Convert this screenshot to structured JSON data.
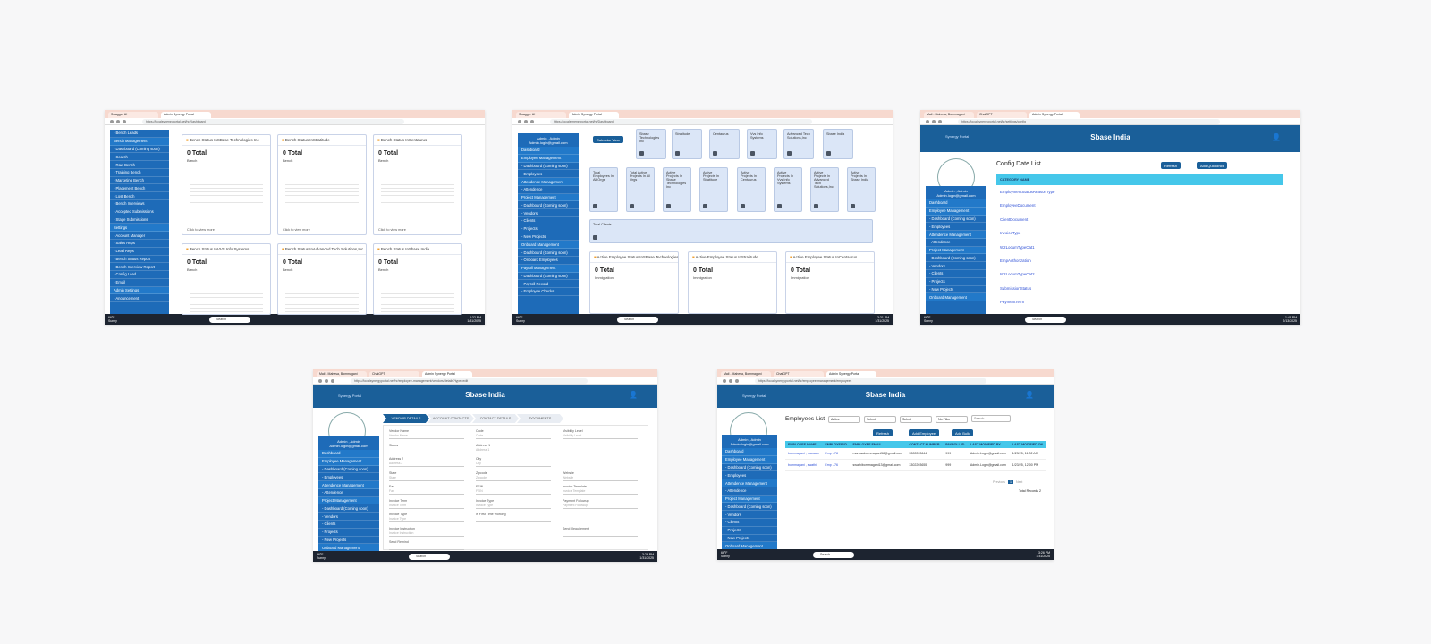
{
  "common": {
    "tab_admin": "Admin Synergy Portal",
    "tab_swagger": "Swagger UI",
    "tab_mail": "Mail - Mahesa, Bommagani",
    "tab_chat": "ChatGPT",
    "not_secure": "Not secure",
    "search": "Search",
    "weather_temp": "66°F",
    "weather_text": "Sunny",
    "user_name": "Admin , Admin",
    "user_email": "Admin.login@gmail.com",
    "app_title": "Sbase India",
    "logo_text": "Synergy Portal"
  },
  "shot1": {
    "url": "https://localsynergyportal.net/hr/Dashboard",
    "time": "2:32 PM",
    "date": "1/31/2025",
    "sidebar": [
      "- Bench Leads",
      "Bench Management",
      "- Dashboard (Coming soon)",
      "- Search",
      "- Raw Bench",
      "- Training Bench",
      "- Marketing Bench",
      "- Placement Bench",
      "- Lost Bench",
      "- Bench Interviews",
      "- Accepted Submissions",
      "- Stage Submissions",
      "Settings",
      "- Account Manager",
      "- Sales Reps",
      "- Lead Reps",
      "- Bench Status Report",
      "- Bench Interview Report",
      "- Config Load",
      "- Email",
      "Admin Settings",
      "- Anouncement"
    ],
    "cards": [
      {
        "title": "Bench Status InSBase Technologies Inc",
        "total": "0 Total",
        "sub": "Bench",
        "foot": "Click to view more"
      },
      {
        "title": "Bench Status InStratitude",
        "total": "0 Total",
        "sub": "Bench",
        "foot": "Click to view more"
      },
      {
        "title": "Bench Status InCentaurus",
        "total": "0 Total",
        "sub": "Bench",
        "foot": "Click to view more"
      },
      {
        "title": "Bench Status InVVS Info Systems",
        "total": "0 Total",
        "sub": "Bench",
        "foot": ""
      },
      {
        "title": "Bench Status InAdvanced Tech Solutions,Inc",
        "total": "0 Total",
        "sub": "Bench",
        "foot": ""
      },
      {
        "title": "Bench Status InSbase India",
        "total": "0 Total",
        "sub": "Bench",
        "foot": ""
      }
    ]
  },
  "shot2": {
    "url": "https://localsynergyportal.net/hr/Dashboard",
    "time": "3:31 PM",
    "date": "1/31/2025",
    "calendar_btn": "Calendar View",
    "sidebar": [
      "Dashboard",
      "Employee Management",
      "- Dashboard (Coming soon)",
      "- Employees",
      "Attendence Management",
      "- Attendence",
      "Project Management",
      "- Dashboard (Coming soon)",
      "- Vendors",
      "- Clients",
      "- Projects",
      "- New Projects",
      "Onboard Management",
      "- Dashboard (Coming soon)",
      "- Onboard Employees",
      "Payroll Management",
      "- Dashboard (Coming soon)",
      "- Payroll Record",
      "- Employee Checks"
    ],
    "top_tiles": [
      "Sbase Technologies Inc",
      "Stratitude",
      "Centaurus",
      "Vvs Info Systems",
      "Advanced Tech Solutions,Inc",
      "Sbase India"
    ],
    "mid_tiles": [
      "Total Employees In All Orgs",
      "Total Active Projects In All Orgs",
      "Active Projects In Sbase Technologies Inc",
      "Active Projects In Stratitude",
      "Active Projects In Centaurus",
      "Active Projects In Vvs Info Systems",
      "Active Projects In Advanced Tech Solutions,Inc",
      "Active Projects In Sbase India"
    ],
    "clients_tile": "Total Clients",
    "cards": [
      {
        "title": "Active Employee Status InSBase Technologies Inc",
        "total": "0 Total",
        "sub": "Immigration"
      },
      {
        "title": "Active Employee Status InStratitude",
        "total": "0 Total",
        "sub": "Immigration"
      },
      {
        "title": "Active Employee Status InCentaurus",
        "total": "0 Total",
        "sub": "Immigration"
      }
    ]
  },
  "shot3": {
    "url": "https://localsynergyportal.net/hr/settings/config",
    "time": "1:48 PM",
    "date": "2/13/2025",
    "heading": "Config Date List",
    "refresh": "Refresh",
    "add_quick": "Add Quicklinks",
    "col": "CATEGORY NAME",
    "rows": [
      "EmploymentStatusReasonType",
      "EmployeeDocument",
      "ClientDocument",
      "InvoiceType",
      "W2LocumTypeCat1",
      "EmpAuthorization",
      "W2LocumTypeCat2",
      "SubmissionStatus",
      "PaymentTerm"
    ],
    "sidebar": [
      "Dashboard",
      "Employee Management",
      "- Dashboard (Coming soon)",
      "- Employees",
      "Attendence Management",
      "- Attendence",
      "Project Management",
      "- Dashboard (Coming soon)",
      "- Vendors",
      "- Clients",
      "- Projects",
      "- New Projects",
      "Onboard Management"
    ]
  },
  "shot4": {
    "url": "https://localsynergyportal.net/hr/employee-management/vendors/details?type=edit",
    "time": "3:26 PM",
    "date": "1/31/2025",
    "steps": [
      "VENDOR DETAILS",
      "ACCOUNT CONTACTS",
      "CONTACT DETAILS",
      "DOCUMENTS"
    ],
    "fields": [
      {
        "l": "Vendor Name",
        "p": "Vendor Name"
      },
      {
        "l": "Code",
        "p": "Code"
      },
      {
        "l": "Visibility Level",
        "p": "Visibility Level"
      },
      {
        "l": "Status",
        "p": ""
      },
      {
        "l": "Address 1",
        "p": "Address 1"
      },
      {
        "l": "",
        "p": ""
      },
      {
        "l": "Address 2",
        "p": "Address 2"
      },
      {
        "l": "City",
        "p": "City"
      },
      {
        "l": "",
        "p": ""
      },
      {
        "l": "State",
        "p": "State"
      },
      {
        "l": "Zipcode",
        "p": "Zipcode"
      },
      {
        "l": "Website",
        "p": "Website"
      },
      {
        "l": "Fax",
        "p": "Fax"
      },
      {
        "l": "FEIN",
        "p": "FEIN"
      },
      {
        "l": "Invoice Template",
        "p": "Invoice Template"
      },
      {
        "l": "Invoice Term",
        "p": "Invoice Term"
      },
      {
        "l": "Invoice Type",
        "p": "Invoice Type"
      },
      {
        "l": "Payment Followup",
        "p": "Payment Followup"
      },
      {
        "l": "Invoice Type",
        "p": "Invoice Type"
      },
      {
        "l": "Is First Time Working",
        "p": ""
      },
      {
        "l": "",
        "p": ""
      },
      {
        "l": "Invoice Instruction",
        "p": "Invoice Instruction"
      },
      {
        "l": "",
        "p": ""
      },
      {
        "l": "Send Requirement",
        "p": ""
      },
      {
        "l": "Send Remind",
        "p": ""
      }
    ],
    "sidebar": [
      "Dashboard",
      "Employee Management",
      "- Dashboard (Coming soon)",
      "- Employees",
      "Attendence Management",
      "- Attendence",
      "Project Management",
      "- Dashboard (Coming soon)",
      "- Vendors",
      "- Clients",
      "- Projects",
      "- New Projects",
      "Onboard Management"
    ]
  },
  "shot5": {
    "url": "https://localsynergyportal.net/hr/employee-management/employees",
    "time": "3:26 PM",
    "date": "1/31/2025",
    "heading": "Employees List",
    "filters": [
      "Active",
      "Select",
      "Select",
      "No Filter"
    ],
    "search_ph": "Search",
    "refresh": "Refresh",
    "add_emp": "Add Employee",
    "add_bulk": "Add Bulk",
    "cols": [
      "EMPLOYEE NAME",
      "EMPLOYEE ID",
      "EMPLOYEE EMAIL",
      "CONTACT NUMBER",
      "PAYROLL ID",
      "LAST MODIFIED BY",
      "LAST MODIFIED ON"
    ],
    "rows": [
      [
        "bommagani , manasa",
        "Emp - 78",
        "manasabommagani58@gmail.com",
        "3302203644",
        "999",
        "Admin.Login@gmail.com",
        "1/23/25, 11:02 AM"
      ],
      [
        "bommagani , swathi",
        "Emp - 76",
        "swathibommagani13@gmail.com",
        "3302203655",
        "999",
        "Admin.Login@gmail.com",
        "1/23/25, 12:00 PM"
      ]
    ],
    "prev": "Previous",
    "page": "1",
    "next": "Next",
    "total": "Total Records 2",
    "sidebar": [
      "Dashboard",
      "Employee Management",
      "- Dashboard (Coming soon)",
      "- Employees",
      "Attendence Management",
      "- Attendence",
      "Project Management",
      "- Dashboard (Coming soon)",
      "- Vendors",
      "- Clients",
      "- Projects",
      "- New Projects",
      "Onboard Management"
    ]
  }
}
